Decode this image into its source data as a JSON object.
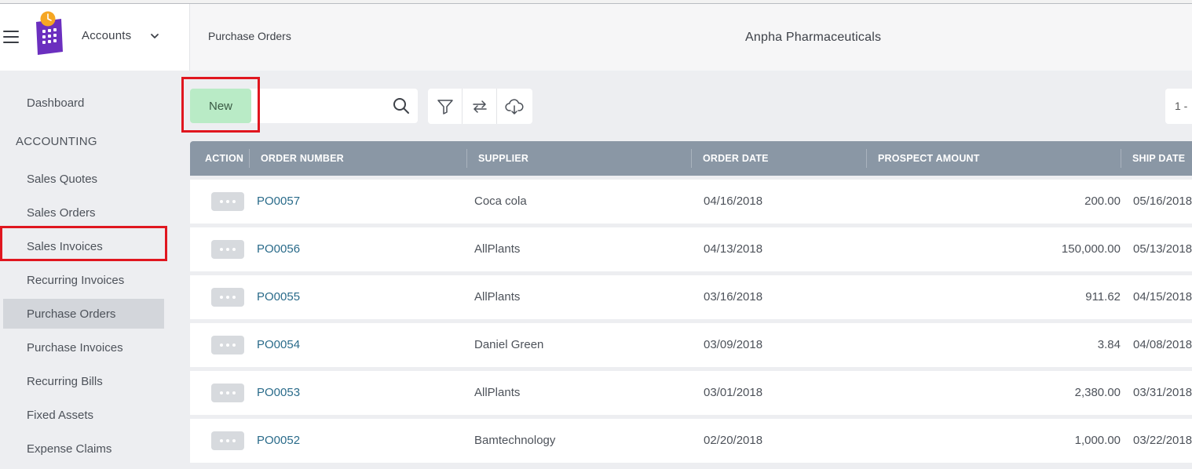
{
  "header": {
    "app_switcher_label": "Accounts",
    "breadcrumb": "Purchase Orders",
    "company_name": "Anpha Pharmaceuticals"
  },
  "sidebar": {
    "dashboard": "Dashboard",
    "section_title": "ACCOUNTING",
    "items": [
      "Sales Quotes",
      "Sales Orders",
      "Sales Invoices",
      "Recurring Invoices",
      "Purchase Orders",
      "Purchase Invoices",
      "Recurring Bills",
      "Fixed Assets",
      "Expense Claims"
    ],
    "active_item": "Purchase Orders"
  },
  "toolbar": {
    "new_label": "New",
    "search_placeholder": "",
    "pagination_text": "1 -"
  },
  "table": {
    "columns": [
      "ACTION",
      "ORDER NUMBER",
      "SUPPLIER",
      "ORDER DATE",
      "PROSPECT AMOUNT",
      "SHIP DATE"
    ],
    "rows": [
      {
        "order_number": "PO0057",
        "supplier": "Coca cola",
        "order_date": "04/16/2018",
        "amount": "200.00",
        "ship_date": "05/16/2018"
      },
      {
        "order_number": "PO0056",
        "supplier": "AllPlants",
        "order_date": "04/13/2018",
        "amount": "150,000.00",
        "ship_date": "05/13/2018"
      },
      {
        "order_number": "PO0055",
        "supplier": "AllPlants",
        "order_date": "03/16/2018",
        "amount": "911.62",
        "ship_date": "04/15/2018"
      },
      {
        "order_number": "PO0054",
        "supplier": "Daniel Green",
        "order_date": "03/09/2018",
        "amount": "3.84",
        "ship_date": "04/08/2018"
      },
      {
        "order_number": "PO0053",
        "supplier": "AllPlants",
        "order_date": "03/01/2018",
        "amount": "2,380.00",
        "ship_date": "03/31/2018"
      },
      {
        "order_number": "PO0052",
        "supplier": "Bamtechnology",
        "order_date": "02/20/2018",
        "amount": "1,000.00",
        "ship_date": "03/22/2018"
      }
    ]
  },
  "colors": {
    "accent_green": "#b9ebc6",
    "table_header": "#8a97a5",
    "link": "#2a6b8a",
    "highlight": "#e0161f",
    "logo_purple": "#6b2fbf",
    "logo_orange": "#f5a623"
  },
  "icons": [
    "menu-icon",
    "calculator-clock-logo",
    "chevron-down-icon",
    "search-icon",
    "filter-icon",
    "swap-icon",
    "cloud-download-icon",
    "more-horizontal-icon"
  ]
}
